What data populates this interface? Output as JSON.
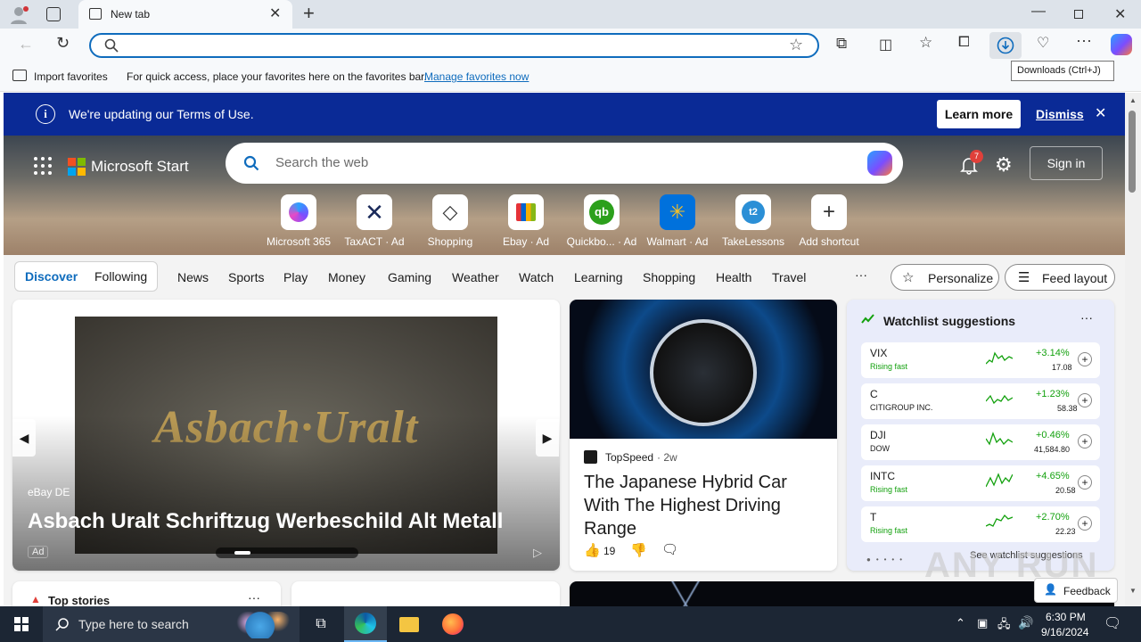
{
  "browser": {
    "tab_title": "New tab",
    "address_value": "",
    "tooltip": "Downloads (Ctrl+J)",
    "favbar": {
      "import_label": "Import favorites",
      "hint": "For quick access, place your favorites here on the favorites bar.",
      "manage_link": "Manage favorites now"
    }
  },
  "banner": {
    "text": "We're updating our Terms of Use.",
    "learn_more": "Learn more",
    "dismiss": "Dismiss"
  },
  "header": {
    "brand": "Microsoft Start",
    "search_placeholder": "Search the web",
    "notif_count": "7",
    "sign_in": "Sign in"
  },
  "shortcuts": [
    {
      "label": "Microsoft 365",
      "icon": "microsoft365-icon"
    },
    {
      "label": "TaxACT · Ad",
      "icon": "taxact-icon"
    },
    {
      "label": "Shopping",
      "icon": "shopping-tag-icon"
    },
    {
      "label": "Ebay · Ad",
      "icon": "ebay-bag-icon"
    },
    {
      "label": "Quickbo... · Ad",
      "icon": "quickbooks-icon"
    },
    {
      "label": "Walmart · Ad",
      "icon": "walmart-icon"
    },
    {
      "label": "TakeLessons",
      "icon": "takelessons-icon"
    },
    {
      "label": "Add shortcut",
      "icon": "plus-icon"
    }
  ],
  "nav": {
    "discover": "Discover",
    "following": "Following",
    "links": [
      "News",
      "Sports",
      "Play",
      "Money",
      "Gaming",
      "Weather",
      "Watch",
      "Learning",
      "Shopping",
      "Health",
      "Travel"
    ],
    "more": "···",
    "personalize": "Personalize",
    "feed_layout": "Feed layout"
  },
  "carousel": {
    "source": "eBay DE",
    "title": "Asbach Uralt Schriftzug Werbeschild Alt Metall",
    "ad_badge": "Ad",
    "sign_text": "Asbach·Uralt"
  },
  "story": {
    "source": "TopSpeed",
    "age": "· 2w",
    "title": "The Japanese Hybrid Car With The Highest Driving Range",
    "likes": "19"
  },
  "watchlist": {
    "title": "Watchlist suggestions",
    "see_more": "See watchlist suggestions",
    "items": [
      {
        "symbol": "VIX",
        "sub": "Rising fast",
        "change": "+3.14%",
        "price": "17.08",
        "rising": true
      },
      {
        "symbol": "C",
        "sub": "CITIGROUP INC.",
        "change": "+1.23%",
        "price": "58.38",
        "rising": false
      },
      {
        "symbol": "DJI",
        "sub": "DOW",
        "change": "+0.46%",
        "price": "41,584.80",
        "rising": false
      },
      {
        "symbol": "INTC",
        "sub": "Rising fast",
        "change": "+4.65%",
        "price": "20.58",
        "rising": true
      },
      {
        "symbol": "T",
        "sub": "Rising fast",
        "change": "+2.70%",
        "price": "22.23",
        "rising": true
      }
    ]
  },
  "bottom": {
    "top_stories": "Top stories",
    "feedback": "Feedback",
    "watermark": "ANY RUN"
  },
  "taskbar": {
    "search_placeholder": "Type here to search",
    "time": "6:30 PM",
    "date": "9/16/2024"
  },
  "colors": {
    "accent": "#0f6cbd",
    "banner": "#0a2a96",
    "positive": "#13a10e",
    "taskbar": "#1c2634"
  }
}
